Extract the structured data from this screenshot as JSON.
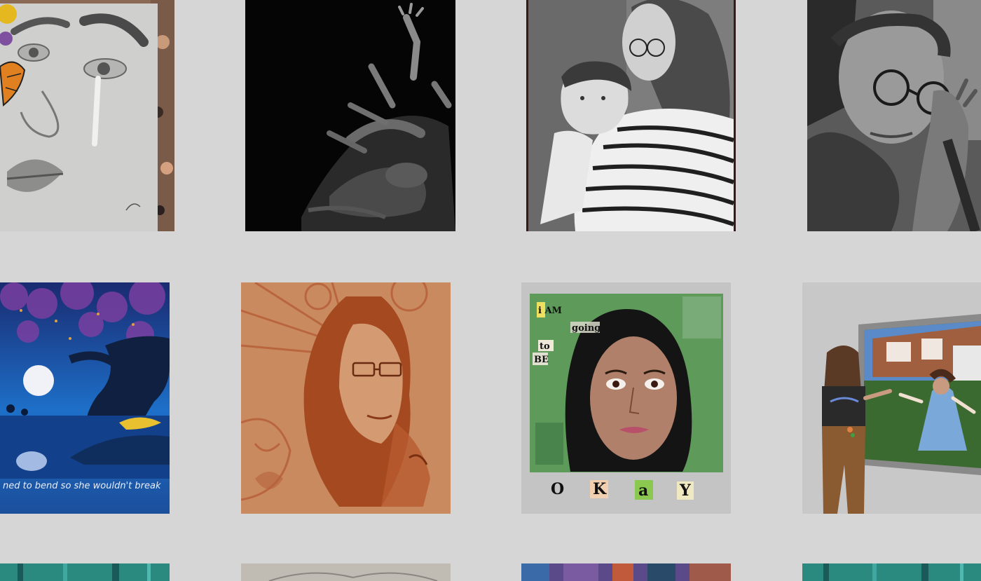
{
  "gallery": {
    "artworks": [
      {
        "subject": "crying-face-butterfly-drawing"
      },
      {
        "subject": "dark-hands-figure-drawing"
      },
      {
        "subject": "mother-and-baby-drawing"
      },
      {
        "subject": "elderly-woman-glasses-drawing"
      },
      {
        "subject": "moonlit-tree-painting",
        "caption": "ned to bend so she wouldn't break"
      },
      {
        "subject": "sepia-portrait-drawing"
      },
      {
        "subject": "collage-portrait-painting",
        "words": {
          "line1": "i AM",
          "line2": "going",
          "line3": "to",
          "line4": "BE"
        },
        "letters": [
          "O",
          "K",
          "a",
          "Y"
        ]
      },
      {
        "subject": "girl-at-window-painting"
      },
      {
        "subject": "teal-artwork-partial"
      },
      {
        "subject": "pencil-artwork-partial"
      },
      {
        "subject": "colorful-artwork-partial"
      },
      {
        "subject": "teal-artwork-partial-2"
      }
    ]
  },
  "colors": {
    "background": "#d6d6d6",
    "sepia": "#b8623a",
    "collage_green": "#5e9a5a",
    "night_blue": "#1b4f9c"
  }
}
